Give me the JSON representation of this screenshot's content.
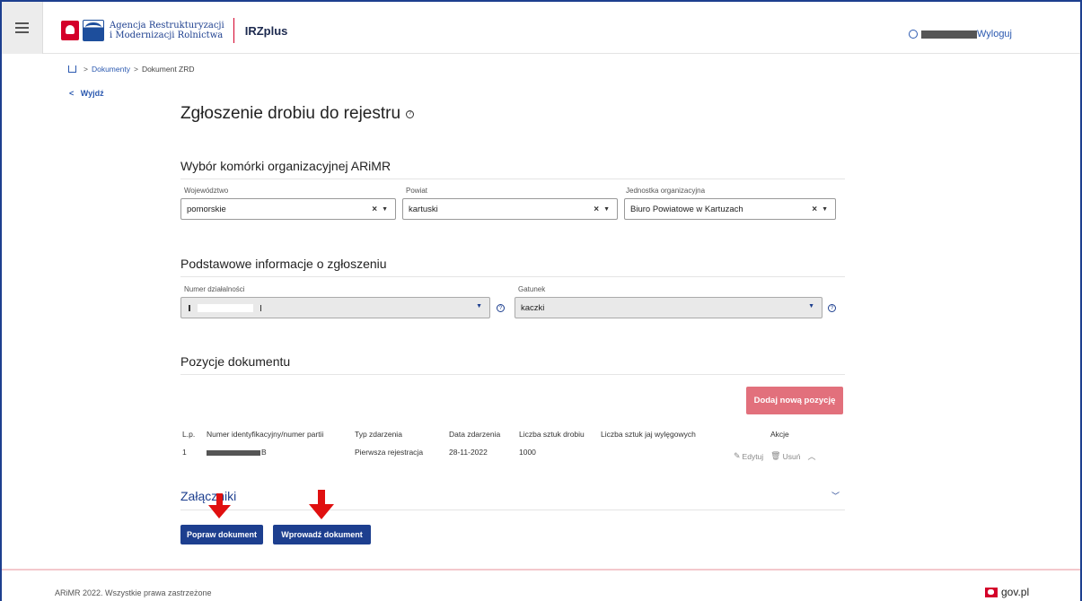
{
  "header": {
    "agency_line1": "Agencja Restrukturyzacji",
    "agency_line2": "i Modernizacji Rolnictwa",
    "app_name": "IRZplus",
    "logout_label": "Wyloguj"
  },
  "breadcrumb": {
    "items": [
      "Dokumenty",
      "Dokument ZRD"
    ],
    "separator": ">"
  },
  "nav": {
    "exit_label": "Wyjdź",
    "exit_chevron": "<"
  },
  "page": {
    "title": "Zgłoszenie drobiu do rejestru"
  },
  "section_org": {
    "title": "Wybór komórki organizacyjnej ARiMR",
    "fields": [
      {
        "label": "Województwo",
        "value": "pomorskie"
      },
      {
        "label": "Powiat",
        "value": "kartuski"
      },
      {
        "label": "Jednostka organizacyjna",
        "value": "Biuro Powiatowe w Kartuzach"
      }
    ]
  },
  "section_basic": {
    "title": "Podstawowe informacje o zgłoszeniu",
    "fields": [
      {
        "label": "Numer działalności",
        "value": ""
      },
      {
        "label": "Gatunek",
        "value": "kaczki"
      }
    ]
  },
  "section_positions": {
    "title": "Pozycje dokumentu",
    "add_button": "Dodaj nową pozycję",
    "columns": [
      "L.p.",
      "Numer identyfikacyjny/numer partii",
      "Typ zdarzenia",
      "Data zdarzenia",
      "Liczba sztuk drobiu",
      "Liczba sztuk jaj wylęgowych",
      "Akcje"
    ],
    "rows": [
      {
        "lp": "1",
        "id_suffix": "B",
        "event_type": "Pierwsza rejestracja",
        "event_date": "28-11-2022",
        "poultry_count": "1000",
        "eggs_count": ""
      }
    ],
    "actions": {
      "edit": "Edytuj",
      "delete": "Usuń"
    }
  },
  "attachments": {
    "title": "Załączniki"
  },
  "buttons": {
    "correct": "Popraw dokument",
    "submit": "Wprowadź dokument"
  },
  "footer": {
    "copyright": "ARiMR 2022. Wszystkie prawa zastrzeżone",
    "gov": "gov.pl"
  },
  "colors": {
    "primary": "#1d3f8f",
    "add_button": "#e2707c",
    "arrow": "#e01010"
  }
}
